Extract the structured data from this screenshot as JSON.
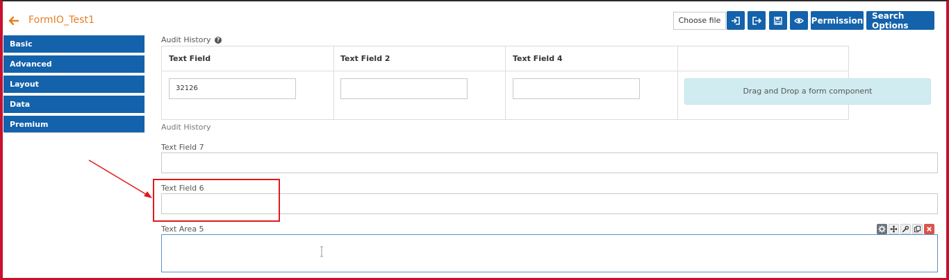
{
  "header": {
    "title": "FormIO_Test1"
  },
  "toolbar": {
    "choose_file": "Choose file",
    "import_icon": "sign-in-icon",
    "export_icon": "sign-out-icon",
    "save_icon": "save-icon",
    "preview_icon": "eye-icon",
    "permission_label": "Permission",
    "search_options_label": "Search Options"
  },
  "sidebar": {
    "items": [
      {
        "label": "Basic"
      },
      {
        "label": "Advanced"
      },
      {
        "label": "Layout"
      },
      {
        "label": "Data"
      },
      {
        "label": "Premium"
      }
    ]
  },
  "grid": {
    "title": "Audit History",
    "footer_label": "Audit History",
    "columns": [
      {
        "header": "Text Field",
        "value": "32126"
      },
      {
        "header": "Text Field 2",
        "value": ""
      },
      {
        "header": "Text Field 4",
        "value": ""
      }
    ],
    "dropzone_text": "Drag and Drop a form component"
  },
  "fields": {
    "text_field_7": {
      "label": "Text Field 7",
      "value": ""
    },
    "text_field_6": {
      "label": "Text Field 6",
      "value": ""
    },
    "text_area_5": {
      "label": "Text Area 5",
      "value": ""
    }
  },
  "component_tools": [
    "gear-icon",
    "move-icon",
    "wrench-icon",
    "copy-icon",
    "close-icon"
  ],
  "colors": {
    "primary": "#1362ab",
    "title_orange": "#e67e22",
    "annotation_red": "#e01818",
    "dropzone_bg": "#d1ecf1"
  }
}
